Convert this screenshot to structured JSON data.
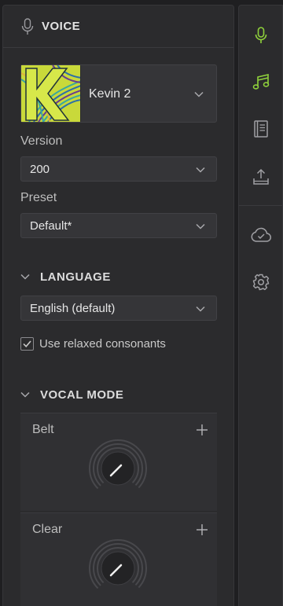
{
  "panel": {
    "title": "VOICE",
    "voice": {
      "name": "Kevin 2",
      "art_letter": "K"
    },
    "version": {
      "label": "Version",
      "value": "200"
    },
    "preset": {
      "label": "Preset",
      "value": "Default*"
    }
  },
  "language": {
    "title": "LANGUAGE",
    "value": "English (default)",
    "relaxed": {
      "label": "Use relaxed consonants",
      "checked": true
    }
  },
  "vocal_mode": {
    "title": "VOCAL MODE",
    "modes": [
      {
        "name": "Belt"
      },
      {
        "name": "Clear"
      }
    ]
  },
  "sidebar": {
    "items": [
      {
        "icon": "microphone-icon",
        "active": true
      },
      {
        "icon": "music-notes-icon",
        "active": true
      },
      {
        "icon": "book-icon",
        "active": false
      },
      {
        "icon": "export-icon",
        "active": false
      },
      {
        "icon": "cloud-check-icon",
        "active": false
      },
      {
        "icon": "gear-icon",
        "active": false
      }
    ]
  },
  "colors": {
    "accent": "#8fd13b",
    "bg": "#1f1f21",
    "panel": "#2b2b2d",
    "field": "#353538"
  }
}
